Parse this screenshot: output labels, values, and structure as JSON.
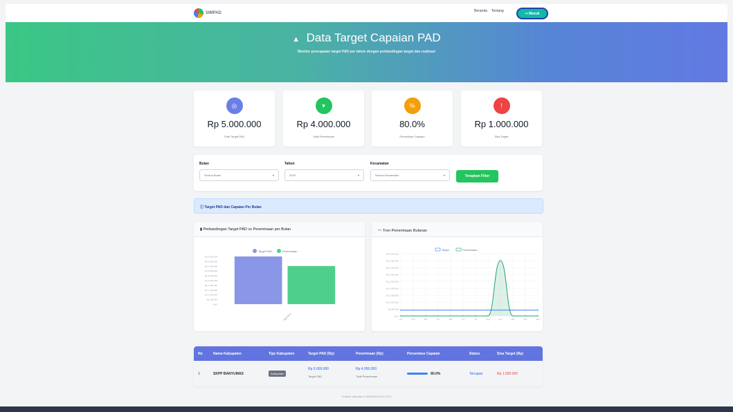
{
  "header": {
    "logo_text": "SIMPAD",
    "nav": [
      "Beranda",
      "Tentang"
    ],
    "login_label": "Masuk",
    "login_icon": "login-icon"
  },
  "hero": {
    "icon": "chart-icon",
    "title": "Data Target Capaian PAD",
    "subtitle": "Monitor pencapaian target PAD per tahun dengan perbandingan target dan realisasi"
  },
  "stats": [
    {
      "icon": "bullseye-icon",
      "color": "#6a7fe6",
      "value": "Rp 5.000.000",
      "label": "Total Target PAD"
    },
    {
      "icon": "wallet-icon",
      "color": "#22c55e",
      "value": "Rp 4.000.000",
      "label": "Total Penerimaan"
    },
    {
      "icon": "percent-icon",
      "color": "#f59e0b",
      "value": "80.0%",
      "label": "Persentase Capaian"
    },
    {
      "icon": "alert-icon",
      "color": "#ef4444",
      "value": "Rp 1.000.000",
      "label": "Sisa Target"
    }
  ],
  "filters": {
    "groups": [
      {
        "label": "Bulan",
        "value": "Semua Bulan"
      },
      {
        "label": "Tahun",
        "value": "2025"
      },
      {
        "label": "Kecamatan",
        "value": "Semua Kecamatan"
      }
    ],
    "apply_label": "Terapkan Filter"
  },
  "infobar": "Target PAD dan Capaian Per Bulan",
  "charts": {
    "bar_title": "Perbandingan Target PAD vs Penerimaan per Bulan",
    "line_title": "Tren Penerimaan Bulanan"
  },
  "chart_data": [
    {
      "type": "bar",
      "series": [
        {
          "name": "Target PAD",
          "color": "#8a97e6",
          "values": [
            5000000
          ]
        },
        {
          "name": "Penerimaan",
          "color": "#4fd08a",
          "values": [
            4000000
          ]
        }
      ],
      "categories": [
        "Agustus"
      ],
      "ylim": [
        0,
        5000000
      ],
      "legend": "top"
    },
    {
      "type": "line",
      "series": [
        {
          "name": "Target",
          "color": "#3b82f6",
          "values": [
            416667,
            416667,
            416667,
            416667,
            416667,
            416667,
            416667,
            416667,
            416667,
            416667,
            416667,
            416667
          ]
        },
        {
          "name": "Penerimaan",
          "color": "#22a06b",
          "values": [
            0,
            0,
            0,
            0,
            0,
            0,
            0,
            0,
            4000000,
            0,
            0,
            0
          ]
        }
      ],
      "categories": [
        "Jan",
        "Feb",
        "Mar",
        "Apr",
        "Mei",
        "Jun",
        "Jul",
        "Agu",
        "Sep",
        "Okt",
        "Nov",
        "Des"
      ],
      "ylim": [
        0,
        4500000
      ],
      "grid": true,
      "legend": "top"
    }
  ],
  "table": {
    "headers": [
      "No",
      "Nama Kabupaten",
      "Tipe Kabupaten",
      "Target PAD (Rp)",
      "Penerimaan (Rp)",
      "Persentase Capaian",
      "Status",
      "Sisa Target (Rp)"
    ],
    "rows": [
      {
        "no": "1",
        "name": "SKPP BANYUMAS",
        "type": "Kabupaten",
        "target": "Rp 5.000.000",
        "target_sub": "Target PAD",
        "received": "Rp 4.000.000",
        "received_sub": "Total Penerimaan",
        "percent": "80.0%",
        "status": "Tercapai",
        "remaining": "Rp 1.000.000"
      }
    ]
  },
  "footnote": "Terakhir diperbarui: 08/08/2025 09:13:21"
}
